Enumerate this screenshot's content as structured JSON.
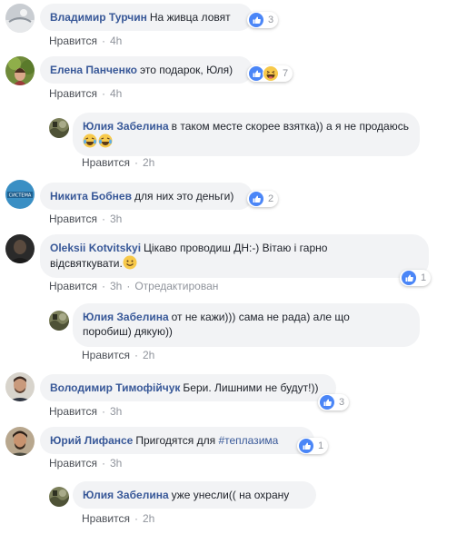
{
  "comments": [
    {
      "author": "Владимир Турчин",
      "text": "На живца ловят",
      "like_label": "Нравится",
      "time": "4h",
      "reaction_count": "3"
    },
    {
      "author": "Елена Панченко",
      "text": "это подарок, Юля)",
      "like_label": "Нравится",
      "time": "4h",
      "reaction_count": "7"
    },
    {
      "author": "Юлия Забелина",
      "text": "в таком месте скорее взятка)) а я не продаюсь",
      "like_label": "Нравится",
      "time": "2h"
    },
    {
      "author": "Никита Бобнев",
      "text": "для них это деньги)",
      "like_label": "Нравится",
      "time": "3h",
      "reaction_count": "2",
      "avatar_text": "СИСТЕМА"
    },
    {
      "author": "Oleksii Kotvitskyi",
      "text_line1": "Цікаво проводиш ДН:-) Вітаю і гарно",
      "text_line2": "відсвяткувати.",
      "like_label": "Нравится",
      "time": "3h",
      "edited": "Отредактирован",
      "reaction_count": "1"
    },
    {
      "author": "Юлия Забелина",
      "text_line1": "от не кажи))) сама не рада) але що",
      "text_line2": "поробиш) дякую))",
      "like_label": "Нравится",
      "time": "2h"
    },
    {
      "author": "Володимир Тимофійчук",
      "text": "Бери. Лишними не будут!))",
      "like_label": "Нравится",
      "time": "3h",
      "reaction_count": "3"
    },
    {
      "author": "Юрий Лифансе",
      "text_prefix": "Пригодятся для",
      "hashtag": "#теплазима",
      "like_label": "Нравится",
      "time": "3h",
      "reaction_count": "1"
    },
    {
      "author": "Юлия Забелина",
      "text": "уже унесли(( на охрану",
      "like_label": "Нравится",
      "time": "2h"
    }
  ],
  "separator": "·",
  "colors": {
    "author": "#385898",
    "bubble": "#f2f3f5",
    "meta": "#90949c",
    "like_blue": "#4b86f7",
    "haha_yellow": "#f7c94a"
  },
  "icons": {
    "like": "thumbs-up-icon",
    "haha": "laughing-face-icon",
    "smile": "smiling-face-icon",
    "tears": "tears-of-joy-icon"
  }
}
